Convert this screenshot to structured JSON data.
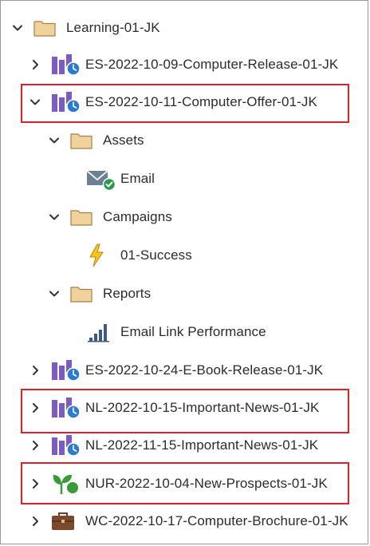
{
  "tree": {
    "root": {
      "label": "Learning-01-JK"
    },
    "items": [
      {
        "label": "ES-2022-10-09-Computer-Release-01-JK"
      },
      {
        "label": "ES-2022-10-11-Computer-Offer-01-JK"
      },
      {
        "label": "Assets"
      },
      {
        "label": "Email"
      },
      {
        "label": "Campaigns"
      },
      {
        "label": "01-Success"
      },
      {
        "label": "Reports"
      },
      {
        "label": "Email Link Performance"
      },
      {
        "label": "ES-2022-10-24-E-Book-Release-01-JK"
      },
      {
        "label": "NL-2022-10-15-Important-News-01-JK"
      },
      {
        "label": "NL-2022-11-15-Important-News-01-JK"
      },
      {
        "label": "NUR-2022-10-04-New-Prospects-01-JK"
      },
      {
        "label": "WC-2022-10-17-Computer-Brochure-01-JK"
      }
    ]
  },
  "colors": {
    "highlight": "#e0202d",
    "folder": "#e9c98c",
    "program_purple": "#7c5cc4",
    "clock_blue": "#2b7bd6",
    "check_green": "#2e9a4e",
    "nurture_green": "#3a9a3a",
    "bolt_yellow": "#f5c518",
    "briefcase_brown": "#7a4a2a"
  },
  "icons": [
    "folder-icon",
    "program-clock-icon",
    "email-check-icon",
    "lightning-icon",
    "bar-chart-icon",
    "nurture-icon",
    "briefcase-icon",
    "chevron-down-icon",
    "chevron-right-icon"
  ]
}
